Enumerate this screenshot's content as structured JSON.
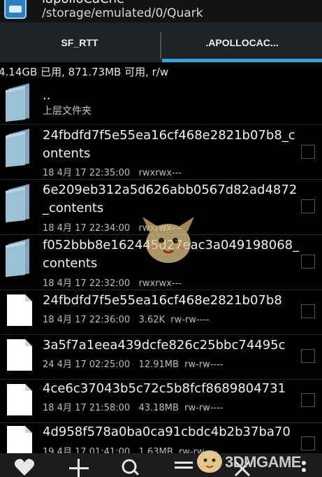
{
  "window": {
    "title": "lapolloCaChe",
    "path": "/storage/emulated/0/Quark"
  },
  "tabs": [
    {
      "label": "SF_RTT",
      "active": false
    },
    {
      "label": ".APOLLOCAC...",
      "active": true
    }
  ],
  "storage_info": "4.14GB 已用, 871.73MB 可用, r/w",
  "parent": {
    "name": "..",
    "label": "上层文件夹"
  },
  "files": [
    {
      "type": "folder",
      "name": "24fbdfd7f5e55ea16cf468e2821b07b8_c\nontents",
      "date": "18 4月 17 22:35:00",
      "size": "",
      "perms": "rwxrwx---"
    },
    {
      "type": "folder",
      "name": "6e209eb312a5d626abb0567d82ad4872\n_contents",
      "date": "18 4月 17 22:34:00",
      "size": "",
      "perms": "rwxrwx---"
    },
    {
      "type": "folder",
      "name": "f052bbb8e162445d27eac3a049198068_\ncontents",
      "date": "18 4月 17 22:32:00",
      "size": "",
      "perms": "rwxrwx---"
    },
    {
      "type": "file",
      "name": "24fbdfd7f5e55ea16cf468e2821b07b8",
      "date": "18 4月 17 22:36:00",
      "size": "3.62K",
      "perms": "rw-rw----"
    },
    {
      "type": "file",
      "name": "3a5f7a1eea439dcfe826c25bbc74495c",
      "date": "24 4月 17 02:25:00",
      "size": "12.91MB",
      "perms": "rw-rw----"
    },
    {
      "type": "file",
      "name": "4ce6c37043b5c72c5b8fcf8689804731",
      "date": "18 4月 17 21:58:00",
      "size": "43.18MB",
      "perms": "rw-rw----"
    },
    {
      "type": "file",
      "name": "4d958f578a0ba0ca91cbdc4b2b37ba70",
      "date": "19 4月 17 01:41:00",
      "size": "1.63MB",
      "perms": "rw-rw----"
    }
  ],
  "bottom_icons": [
    "heart-icon",
    "plus-icon",
    "search-icon",
    "menu-icon",
    "close-icon",
    "more-icon"
  ],
  "watermark": "3DMGAME",
  "colors": {
    "accent": "#35a7dd",
    "folder": "#8aaec4",
    "background": "#000000"
  }
}
